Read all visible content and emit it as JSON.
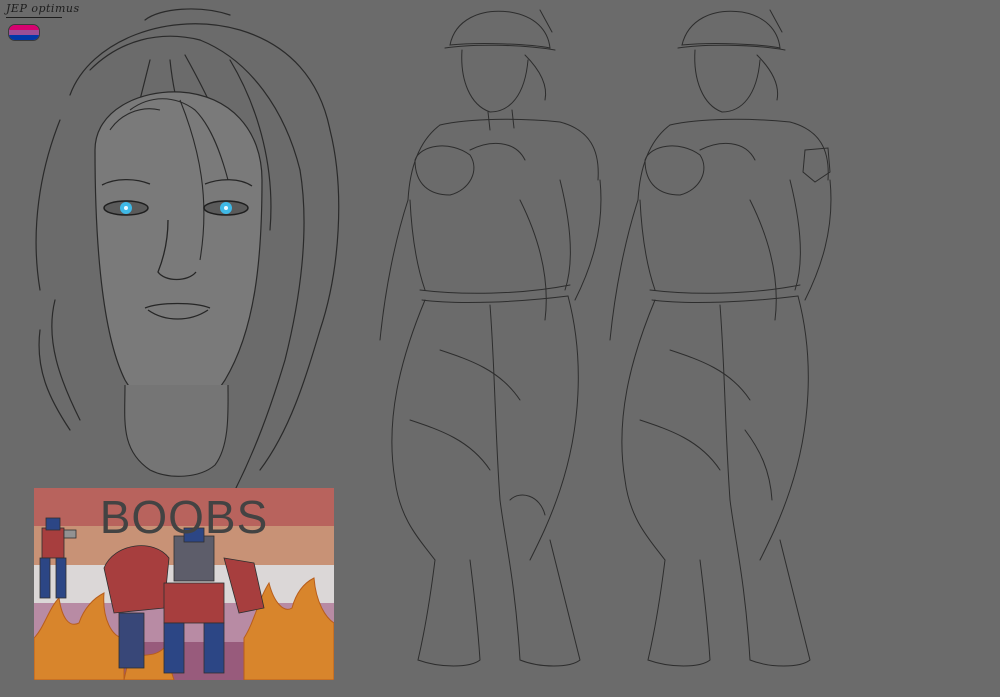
{
  "canvas": {
    "background": "#6b6b6b",
    "line_color": "#2a2a2a",
    "eye_color": "#3fb9e6"
  },
  "signature": {
    "text": "JEP optimus"
  },
  "flag_badge": {
    "icon": "bisexual-flag-icon",
    "colors": [
      "#d60270",
      "#9b4f96",
      "#0038a8"
    ]
  },
  "poster": {
    "caption": "BOOBS",
    "stripe_colors": [
      "#c9615a",
      "#dc9a78",
      "#f3eeee",
      "#c992b0",
      "#a2577f"
    ],
    "flame_color": "#f08a1e"
  }
}
